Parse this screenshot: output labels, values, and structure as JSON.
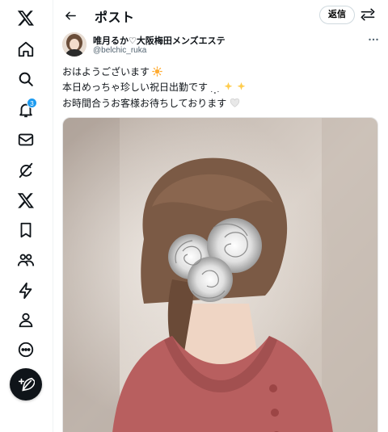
{
  "sidebar": {
    "items": [
      {
        "icon": "x-logo-icon"
      },
      {
        "icon": "home-icon"
      },
      {
        "icon": "search-icon"
      },
      {
        "icon": "notifications-icon",
        "badge": "3"
      },
      {
        "icon": "messages-icon"
      },
      {
        "icon": "grok-icon"
      },
      {
        "icon": "premium-x-icon"
      },
      {
        "icon": "bookmarks-icon"
      },
      {
        "icon": "communities-icon"
      },
      {
        "icon": "verified-orgs-icon"
      },
      {
        "icon": "profile-icon"
      },
      {
        "icon": "more-icon"
      }
    ],
    "compose_icon": "compose-post-icon"
  },
  "header": {
    "title": "ポスト",
    "reply_label": "返信"
  },
  "post": {
    "display_name": "唯月るか♡大阪梅田メンズエステ",
    "handle": "@belchic_ruka",
    "lines": [
      "おはようございます",
      "本日めっちゃ珍しい祝日出勤です",
      "お時間合うお客様お待ちしております"
    ],
    "emojis": [
      "sun-emoji",
      "sparkles-emoji",
      "white-heart-emoji"
    ]
  },
  "colors": {
    "accent": "#1d9bf0",
    "text": "#0f1419",
    "muted": "#536471",
    "border": "#eff3f4"
  }
}
